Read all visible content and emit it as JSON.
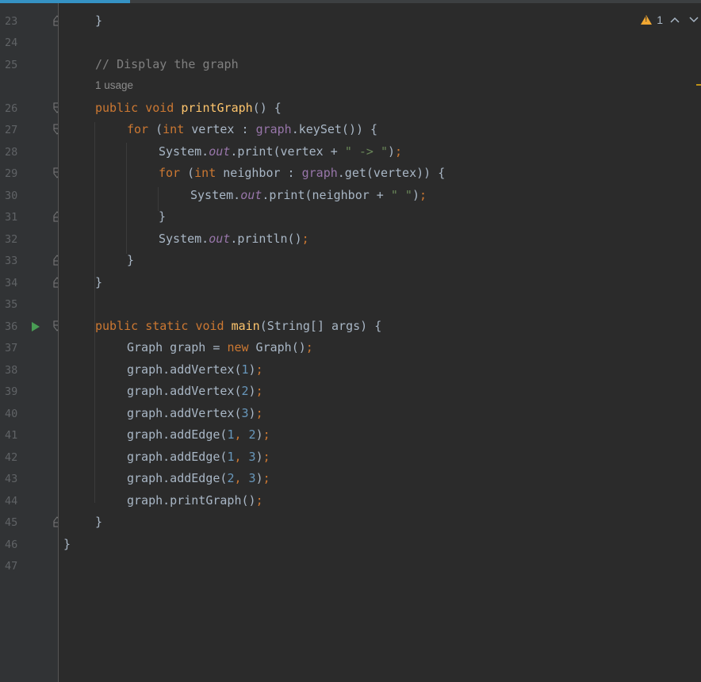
{
  "inspection": {
    "warning_count": "1",
    "warning_icon": "warning-triangle-icon",
    "up_icon": "chevron-up-icon",
    "down_icon": "chevron-down-icon"
  },
  "line_numbers": [
    "23",
    "24",
    "25",
    "26",
    "27",
    "28",
    "29",
    "30",
    "31",
    "32",
    "33",
    "34",
    "35",
    "36",
    "37",
    "38",
    "39",
    "40",
    "41",
    "42",
    "43",
    "44",
    "45",
    "46",
    "47"
  ],
  "code": {
    "l23": "}",
    "l25_comment": "// Display the graph",
    "usage_hint": "1 usage",
    "l26": {
      "kw1": "public",
      "kw2": "void",
      "name": "printGraph",
      "rest": "() {"
    },
    "l27": {
      "kw": "for",
      "p1": " (",
      "type": "int",
      "p2": " vertex : ",
      "field": "graph",
      "p3": ".keySet()) {"
    },
    "l28": {
      "p1": "System.",
      "st": "out",
      "p2": ".print(vertex + ",
      "str": "\" -> \"",
      "p3": ")",
      "semi": ";"
    },
    "l29": {
      "kw": "for",
      "p1": " (",
      "type": "int",
      "p2": " neighbor : ",
      "field": "graph",
      "p3": ".get(vertex)) {"
    },
    "l30": {
      "p1": "System.",
      "st": "out",
      "p2": ".print(neighbor + ",
      "str": "\" \"",
      "p3": ")",
      "semi": ";"
    },
    "l31": "}",
    "l32": {
      "p1": "System.",
      "st": "out",
      "p2": ".println()",
      "semi": ";"
    },
    "l33": "}",
    "l34": "}",
    "l36": {
      "kw1": "public",
      "kw2": "static",
      "kw3": "void",
      "name": "main",
      "rest": "(String[] args) {"
    },
    "l37": {
      "p1": "Graph graph = ",
      "kw": "new",
      "p2": " Graph()",
      "semi": ";"
    },
    "l38": {
      "p1": "graph.addVertex(",
      "num": "1",
      "p2": ")",
      "semi": ";"
    },
    "l39": {
      "p1": "graph.addVertex(",
      "num": "2",
      "p2": ")",
      "semi": ";"
    },
    "l40": {
      "p1": "graph.addVertex(",
      "num": "3",
      "p2": ")",
      "semi": ";"
    },
    "l41": {
      "p1": "graph.addEdge(",
      "n1": "1",
      "comma": ", ",
      "n2": "2",
      "p2": ")",
      "semi": ";"
    },
    "l42": {
      "p1": "graph.addEdge(",
      "n1": "1",
      "comma": ", ",
      "n2": "3",
      "p2": ")",
      "semi": ";"
    },
    "l43": {
      "p1": "graph.addEdge(",
      "n1": "2",
      "comma": ", ",
      "n2": "3",
      "p2": ")",
      "semi": ";"
    },
    "l44": {
      "p1": "graph.printGraph()",
      "semi": ";"
    },
    "l45": "}",
    "l46": "}"
  },
  "colors": {
    "background": "#2b2b2b",
    "gutter": "#313335",
    "keyword": "#cc7832",
    "method": "#ffc66d",
    "field": "#9876aa",
    "string": "#6a8759",
    "number": "#6897bb",
    "comment": "#808080",
    "text": "#a9b7c6",
    "run": "#499c54",
    "warning": "#f0a732"
  }
}
